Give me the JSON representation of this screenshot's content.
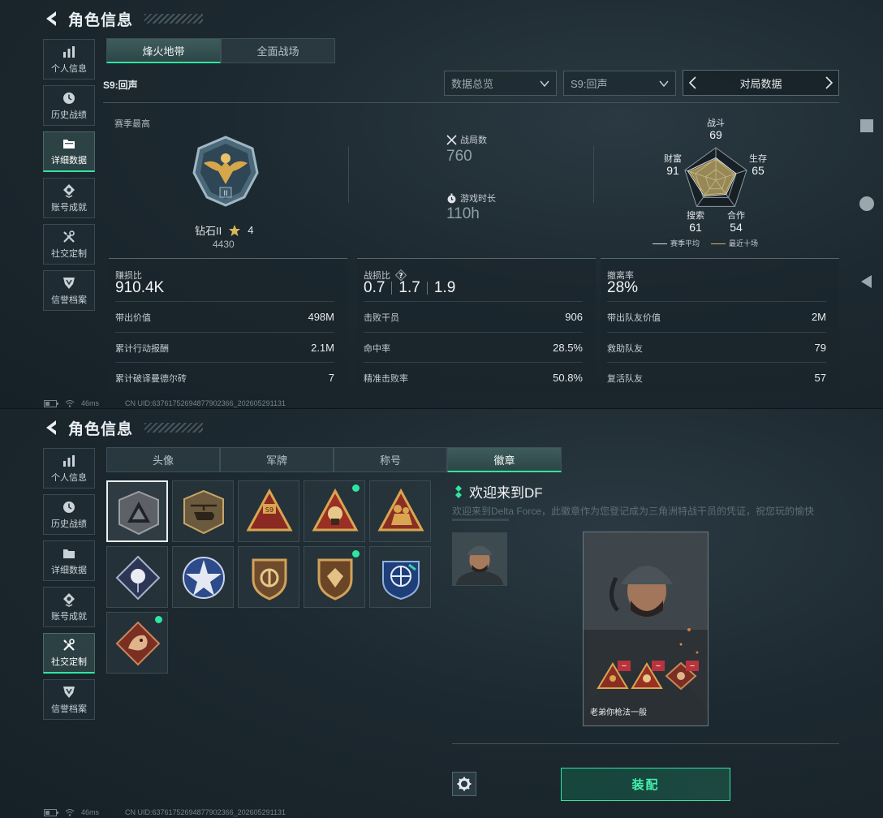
{
  "title": "角色信息",
  "sidebar": [
    {
      "label": "个人信息",
      "icon": "bar-chart-icon"
    },
    {
      "label": "历史战绩",
      "icon": "clock-icon"
    },
    {
      "label": "详细数据",
      "icon": "folder-icon"
    },
    {
      "label": "账号成就",
      "icon": "medal-icon"
    },
    {
      "label": "社交定制",
      "icon": "tools-icon"
    },
    {
      "label": "信誉档案",
      "icon": "shield-icon"
    }
  ],
  "top": {
    "sidebar_active": "详细数据",
    "mode_tabs": [
      "烽火地带",
      "全面战场"
    ],
    "active_tab": "烽火地带",
    "season_label": "S9:回声",
    "filters": {
      "overview": "数据总览",
      "season": "S9:回声",
      "nav": "对局数据"
    },
    "season_high_label": "赛季最高",
    "rank": {
      "name": "钻石II",
      "stars": "4",
      "score": "4430"
    },
    "matches": {
      "label": "战局数",
      "value": "760"
    },
    "playtime": {
      "label": "游戏时长",
      "value": "110h"
    },
    "radar": {
      "axes": [
        {
          "label": "战斗",
          "value": "69"
        },
        {
          "label": "生存",
          "value": "65"
        },
        {
          "label": "合作",
          "value": "54"
        },
        {
          "label": "搜索",
          "value": "61"
        },
        {
          "label": "财富",
          "value": "91"
        }
      ],
      "legend": [
        "赛季平均",
        "最近十场"
      ],
      "colors": {
        "season_avg": "#d8dde0",
        "recent": "#d9b85a"
      }
    },
    "cards": [
      {
        "label": "赚损比",
        "big": "910.4K",
        "rows": [
          {
            "label": "带出价值",
            "value": "498M"
          },
          {
            "label": "累计行动报酬",
            "value": "2.1M"
          },
          {
            "label": "累计破译曼德尔砖",
            "value": "7"
          }
        ]
      },
      {
        "label": "战损比",
        "help": "?",
        "big_parts": [
          "0.7",
          "1.7",
          "1.9"
        ],
        "rows": [
          {
            "label": "击败干员",
            "value": "906"
          },
          {
            "label": "命中率",
            "value": "28.5%"
          },
          {
            "label": "精准击败率",
            "value": "50.8%"
          }
        ]
      },
      {
        "label": "撤离率",
        "big": "28%",
        "rows": [
          {
            "label": "带出队友价值",
            "value": "2M"
          },
          {
            "label": "救助队友",
            "value": "79"
          },
          {
            "label": "复活队友",
            "value": "57"
          }
        ]
      }
    ]
  },
  "status": {
    "ping": "46ms",
    "uid": "CN UID:6376175269487790​2366_202605291131"
  },
  "bottom": {
    "sidebar_active": "社交定制",
    "tabs": [
      "头像",
      "军牌",
      "称号",
      "徽章"
    ],
    "active_tab": "徽章",
    "badges": [
      {
        "name": "df-triangle-badge",
        "new": false,
        "selected": true
      },
      {
        "name": "helicopter-badge",
        "new": false
      },
      {
        "name": "s9-badge",
        "new": false
      },
      {
        "name": "hazmat-badge",
        "new": true
      },
      {
        "name": "soldier-badge",
        "new": false
      },
      {
        "name": "rose-badge",
        "new": false
      },
      {
        "name": "star-badge",
        "new": false
      },
      {
        "name": "shield-badge",
        "new": false
      },
      {
        "name": "gem-badge",
        "new": true
      },
      {
        "name": "globe-badge",
        "new": false
      },
      {
        "name": "dragon-badge",
        "new": true
      }
    ],
    "detail": {
      "title": "欢迎来到DF",
      "description": "欢迎来到Delta Force，此徽章作为您登记成为三角洲特战干员的凭证，祝您玩的愉快",
      "caption": "老弟你枪法一般"
    },
    "equip_label": "装配"
  }
}
